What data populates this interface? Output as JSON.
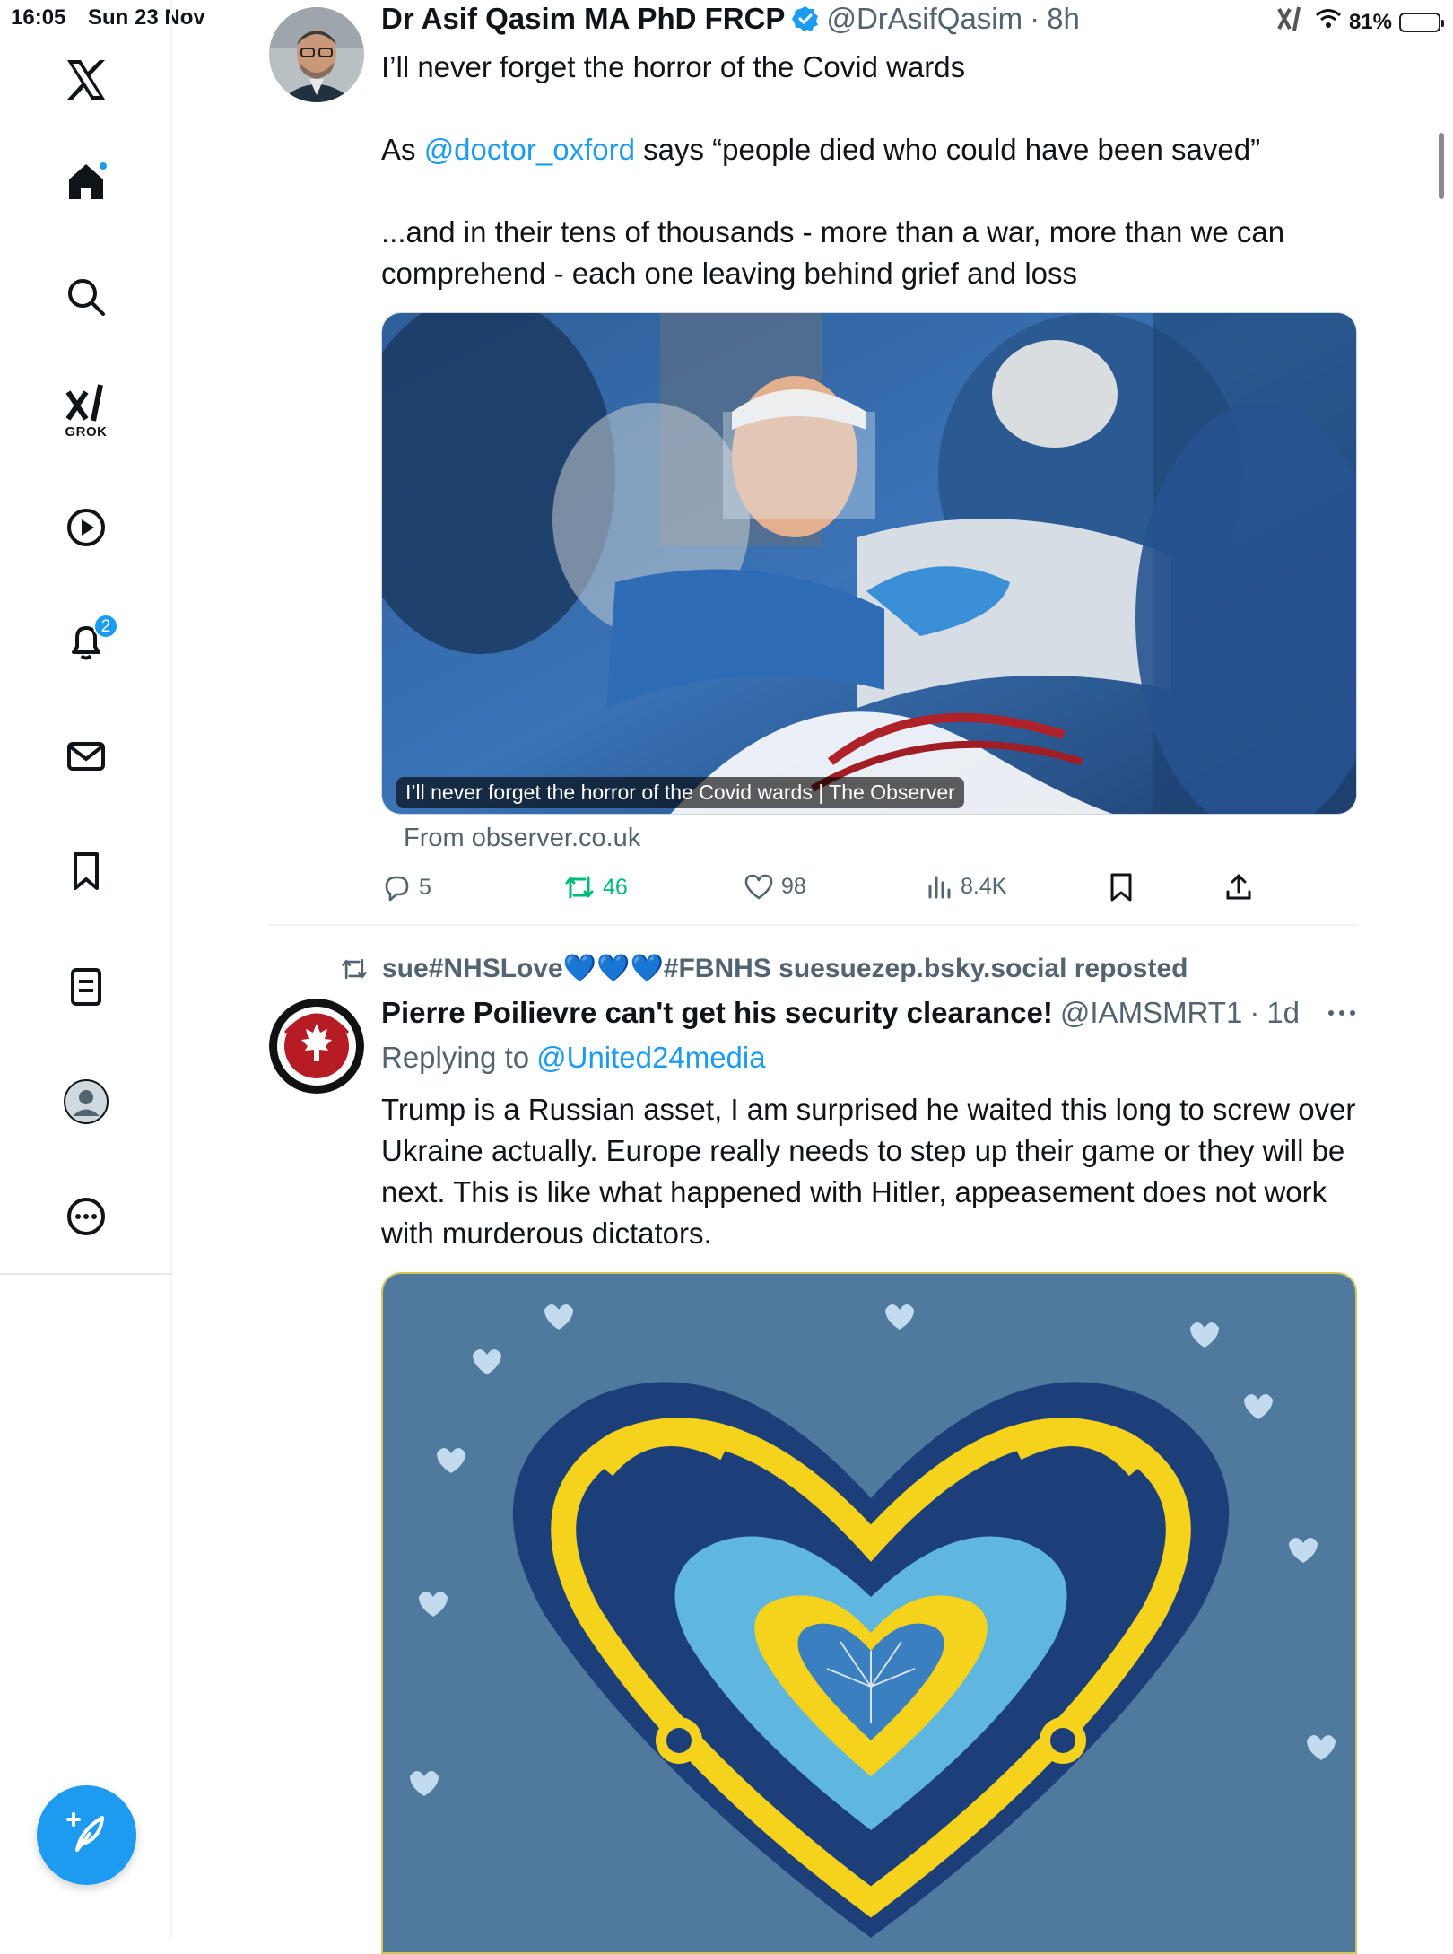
{
  "status_bar": {
    "time": "16:05",
    "date": "Sun 23 Nov",
    "battery": "81%",
    "battery_level": 0.81
  },
  "sidebar": {
    "notification_count": "2",
    "grok_label": "GROK",
    "items": [
      "x-logo",
      "home",
      "search",
      "grok",
      "videos",
      "notifications",
      "messages",
      "bookmarks",
      "lists",
      "profile",
      "more"
    ]
  },
  "tweet1": {
    "display_name": "Dr Asif Qasim MA PhD FRCP",
    "handle": "@DrAsifQasim",
    "time": "8h",
    "line1": "I’ll never forget the horror of the Covid wards",
    "line2_pre": "As ",
    "line2_link": "@doctor_oxford",
    "line2_post": " says “people died who could have been saved”",
    "line3": "...and in their tens of thousands - more than a war, more than we can comprehend - each one leaving behind grief and loss",
    "card_caption": "I’ll never forget the horror of the Covid wards | The Observer",
    "card_domain": "From observer.co.uk",
    "replies": "5",
    "reposts": "46",
    "likes": "98",
    "views": "8.4K"
  },
  "tweet2": {
    "reposted_by": "sue#NHSLove💙💙💙#FBNHS suesuezep.bsky.social reposted",
    "display_name": "Pierre Poilievre can't get his security clearance!",
    "handle": "@IAMSMRT1",
    "time": "1d",
    "replying_label": "Replying to ",
    "replying_to": "@United24media",
    "body": "Trump is a Russian asset, I am surprised he waited this long to screw over Ukraine actually. Europe really needs to step up their game or they will be next. This is like what happened with Hitler, appeasement does not work with murderous dictators."
  },
  "colors": {
    "accent": "#1d9bf0",
    "repost_green": "#00ba7c",
    "muted_text": "#536471",
    "ukraine_blue": "#1f4e8c",
    "ukraine_yellow": "#f5d21b"
  }
}
